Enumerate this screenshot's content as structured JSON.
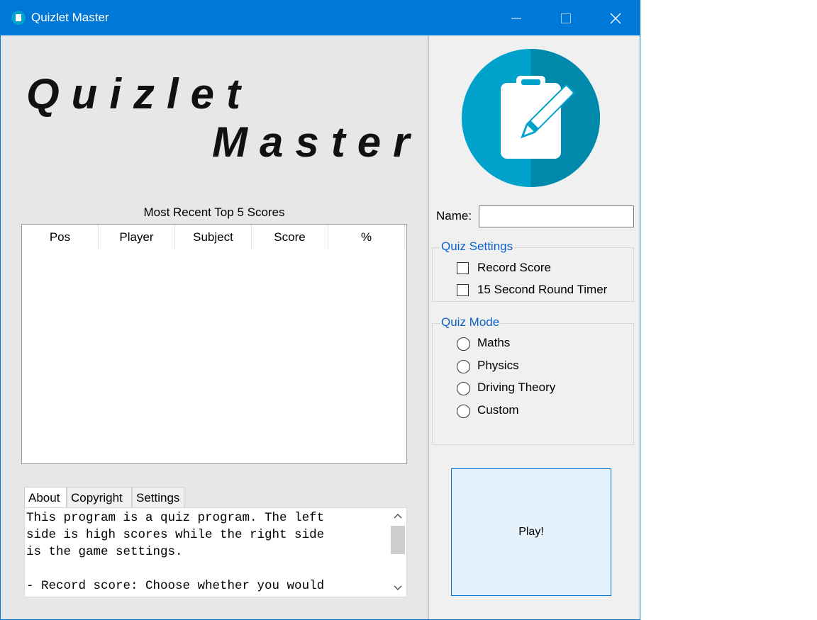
{
  "window": {
    "title": "Quizlet Master",
    "controls": [
      "minimize-icon",
      "maximize-icon",
      "close-icon"
    ]
  },
  "logo": {
    "line1": "Quizlet",
    "line2": "Master"
  },
  "scores": {
    "caption": "Most Recent Top 5 Scores",
    "columns": [
      "Pos",
      "Player",
      "Subject",
      "Score",
      "%"
    ],
    "rows": []
  },
  "info_tabs": {
    "tabs": [
      "About",
      "Copyright",
      "Settings"
    ],
    "active": "About",
    "content": "This program is a quiz program. The left\nside is high scores while the right side\nis the game settings.\n\n- Record score: Choose whether you would"
  },
  "avatar_icon": "clipboard-pencil-icon",
  "name_field": {
    "label": "Name:",
    "value": ""
  },
  "quiz_settings": {
    "title": "Quiz Settings",
    "options": [
      {
        "label": "Record Score",
        "checked": false
      },
      {
        "label": "15 Second Round Timer",
        "checked": false
      }
    ]
  },
  "quiz_mode": {
    "title": "Quiz Mode",
    "options": [
      "Maths",
      "Physics",
      "Driving Theory",
      "Custom"
    ],
    "selected": null
  },
  "play_button": {
    "label": "Play!"
  },
  "colors": {
    "titlebar": "#0078d7",
    "accent_text": "#0a62c7",
    "avatar_light": "#00a2cc",
    "avatar_dark": "#0089aa"
  }
}
